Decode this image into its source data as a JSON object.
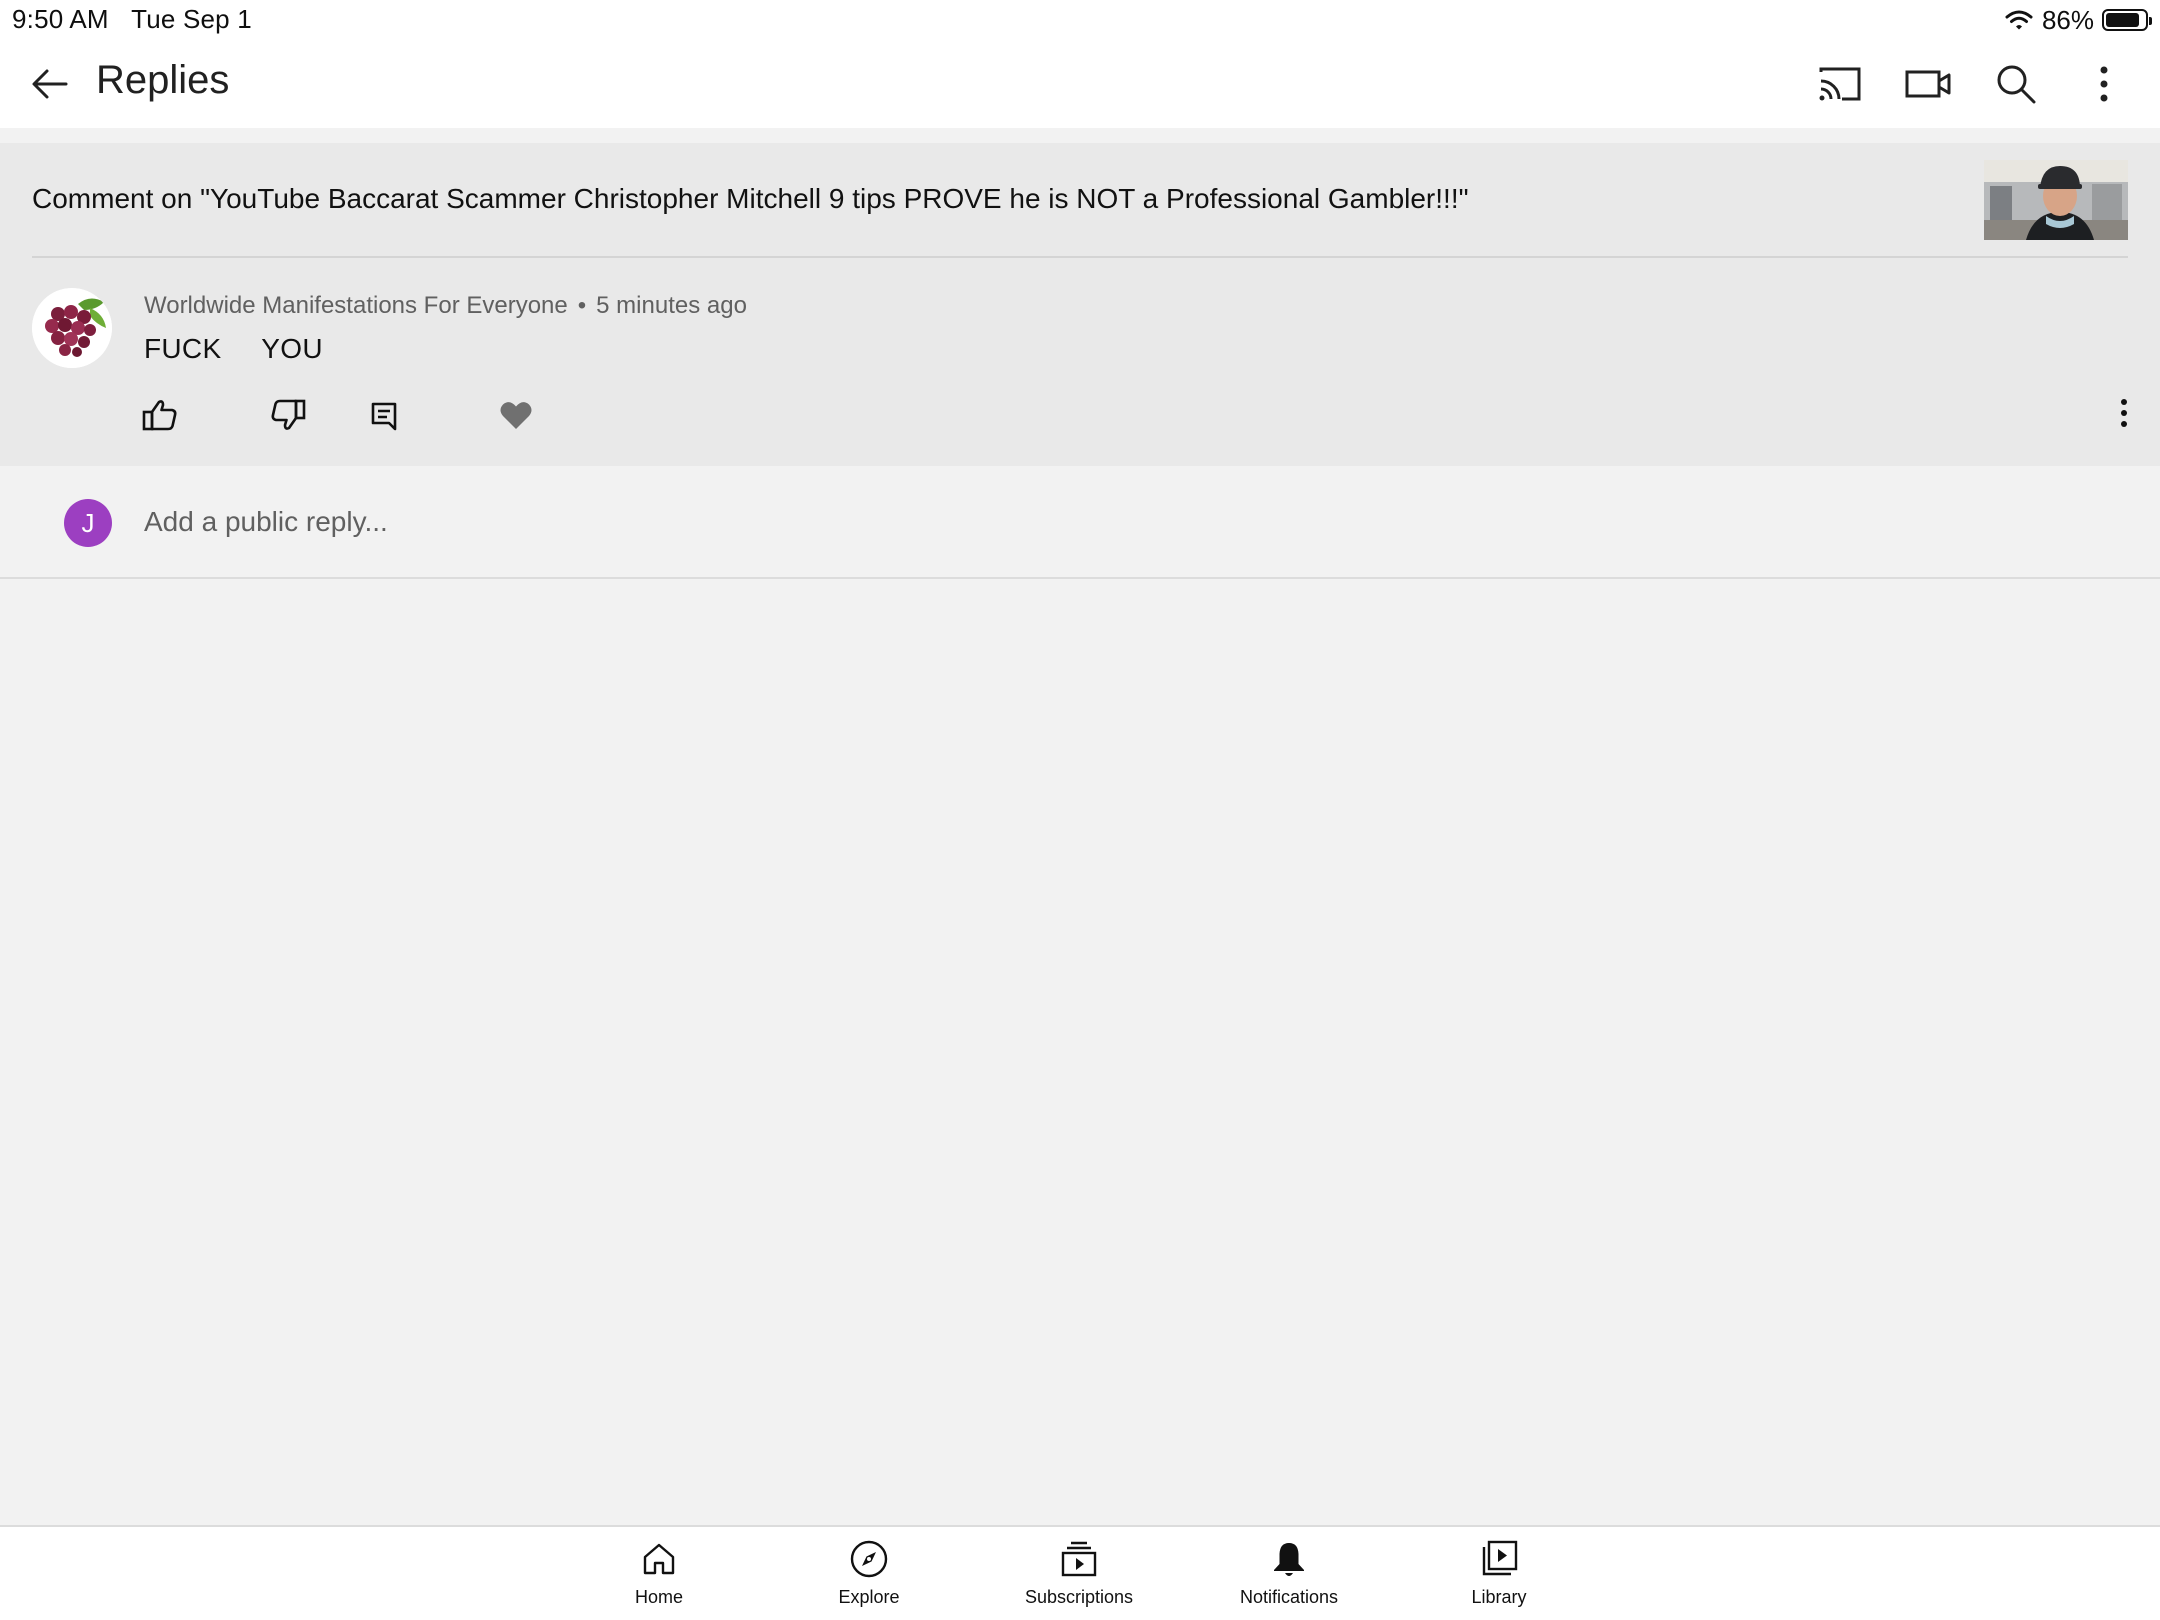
{
  "status_bar": {
    "time": "9:50 AM",
    "date": "Tue Sep 1",
    "battery_text": "86%",
    "battery_level": 0.86
  },
  "app_bar": {
    "title": "Replies",
    "icons": [
      "back-arrow-icon",
      "cast-icon",
      "video-camera-icon",
      "search-icon",
      "more-vert-icon"
    ]
  },
  "comment": {
    "context": "Comment on \"YouTube Baccarat Scammer Christopher Mitchell 9 tips PROVE he is NOT a Professional Gambler!!!\"",
    "author": "Worldwide Manifestations For Everyone",
    "separator": "•",
    "time_ago": "5 minutes ago",
    "text": "FUCK     YOU",
    "actions": [
      "thumb-up-icon",
      "thumb-down-icon",
      "reply-icon",
      "heart-icon",
      "more-vert-icon"
    ]
  },
  "reply_box": {
    "avatar_letter": "J",
    "placeholder": "Add a public reply...",
    "avatar_color": "#9c3fc1"
  },
  "bottom_nav": {
    "items": [
      {
        "label": "Home",
        "icon": "home-icon"
      },
      {
        "label": "Explore",
        "icon": "explore-icon"
      },
      {
        "label": "Subscriptions",
        "icon": "subscriptions-icon"
      },
      {
        "label": "Notifications",
        "icon": "bell-icon"
      },
      {
        "label": "Library",
        "icon": "library-icon"
      }
    ],
    "active": "Notifications"
  }
}
